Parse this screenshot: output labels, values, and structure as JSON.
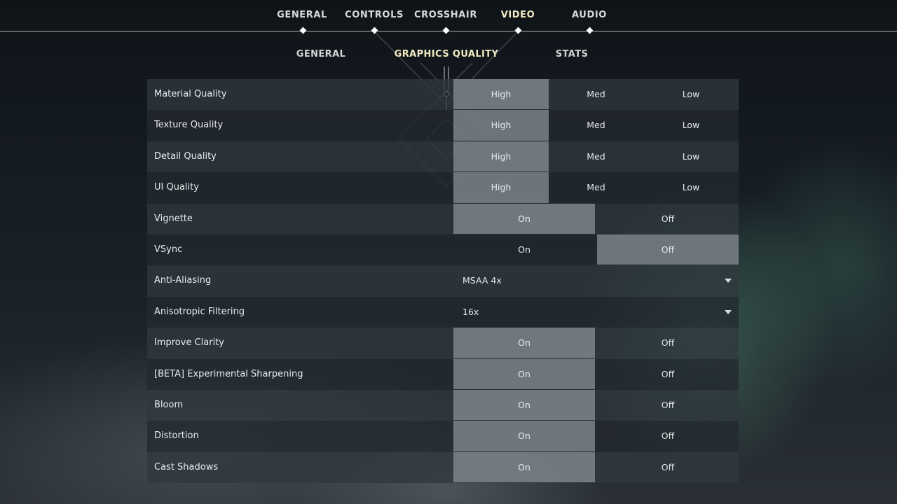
{
  "top_nav": {
    "tabs": [
      {
        "label": "GENERAL",
        "active": false
      },
      {
        "label": "CONTROLS",
        "active": false
      },
      {
        "label": "CROSSHAIR",
        "active": false
      },
      {
        "label": "VIDEO",
        "active": true
      },
      {
        "label": "AUDIO",
        "active": false
      }
    ]
  },
  "sub_nav": {
    "tabs": [
      {
        "label": "GENERAL",
        "active": false
      },
      {
        "label": "GRAPHICS QUALITY",
        "active": true
      },
      {
        "label": "STATS",
        "active": false
      }
    ]
  },
  "colors": {
    "active_tab": "#f0e9c2",
    "selected_option": "#848c93"
  },
  "settings": [
    {
      "label": "Material Quality",
      "type": "choice3",
      "options": [
        "High",
        "Med",
        "Low"
      ],
      "selected": 0
    },
    {
      "label": "Texture Quality",
      "type": "choice3",
      "options": [
        "High",
        "Med",
        "Low"
      ],
      "selected": 0
    },
    {
      "label": "Detail Quality",
      "type": "choice3",
      "options": [
        "High",
        "Med",
        "Low"
      ],
      "selected": 0
    },
    {
      "label": "UI Quality",
      "type": "choice3",
      "options": [
        "High",
        "Med",
        "Low"
      ],
      "selected": 0
    },
    {
      "label": "Vignette",
      "type": "choice2",
      "options": [
        "On",
        "Off"
      ],
      "selected": 0
    },
    {
      "label": "VSync",
      "type": "choice2",
      "options": [
        "On",
        "Off"
      ],
      "selected": 1
    },
    {
      "label": "Anti-Aliasing",
      "type": "dropdown",
      "value": "MSAA 4x"
    },
    {
      "label": "Anisotropic Filtering",
      "type": "dropdown",
      "value": "16x"
    },
    {
      "label": "Improve Clarity",
      "type": "choice2",
      "options": [
        "On",
        "Off"
      ],
      "selected": 0
    },
    {
      "label": "[BETA] Experimental Sharpening",
      "type": "choice2",
      "options": [
        "On",
        "Off"
      ],
      "selected": 0
    },
    {
      "label": "Bloom",
      "type": "choice2",
      "options": [
        "On",
        "Off"
      ],
      "selected": 0
    },
    {
      "label": "Distortion",
      "type": "choice2",
      "options": [
        "On",
        "Off"
      ],
      "selected": 0
    },
    {
      "label": "Cast Shadows",
      "type": "choice2",
      "options": [
        "On",
        "Off"
      ],
      "selected": 0
    }
  ]
}
